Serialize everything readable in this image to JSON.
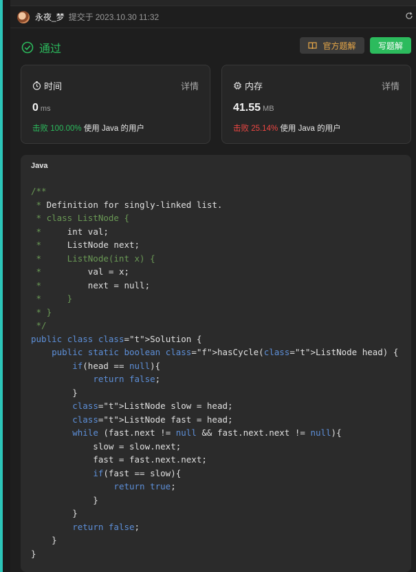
{
  "header": {
    "username": "永夜_梦",
    "submit_label": "提交于",
    "submit_time": "2023.10.30 11:32",
    "refresh_icon": "refresh-icon"
  },
  "status": {
    "label": "通过",
    "icon": "check-circle-icon",
    "color": "#2cbb5d"
  },
  "buttons": {
    "official_solution": "官方题解",
    "write_solution": "写题解"
  },
  "runtime": {
    "title": "时间",
    "detail": "详情",
    "value": "0",
    "unit": "ms",
    "beat_percent": "击败 100.00%",
    "beat_suffix": "使用 Java 的用户"
  },
  "memory": {
    "title": "内存",
    "detail": "详情",
    "value": "41.55",
    "unit": "MB",
    "beat_percent": "击败 25.14%",
    "beat_suffix": "使用 Java 的用户"
  },
  "code": {
    "language": "Java",
    "lines": [
      "/**",
      " * Definition for singly-linked list.",
      " * class ListNode {",
      " *     int val;",
      " *     ListNode next;",
      " *     ListNode(int x) {",
      " *         val = x;",
      " *         next = null;",
      " *     }",
      " * }",
      " */",
      "public class Solution {",
      "    public static boolean hasCycle(ListNode head) {",
      "        if(head == null){",
      "            return false;",
      "        }",
      "        ListNode slow = head;",
      "        ListNode fast = head;",
      "        while (fast.next != null && fast.next.next != null){",
      "            slow = slow.next;",
      "            fast = fast.next.next;",
      "            if(fast == slow){",
      "                return true;",
      "            }",
      "        }",
      "        return false;",
      "    }",
      "}"
    ]
  }
}
